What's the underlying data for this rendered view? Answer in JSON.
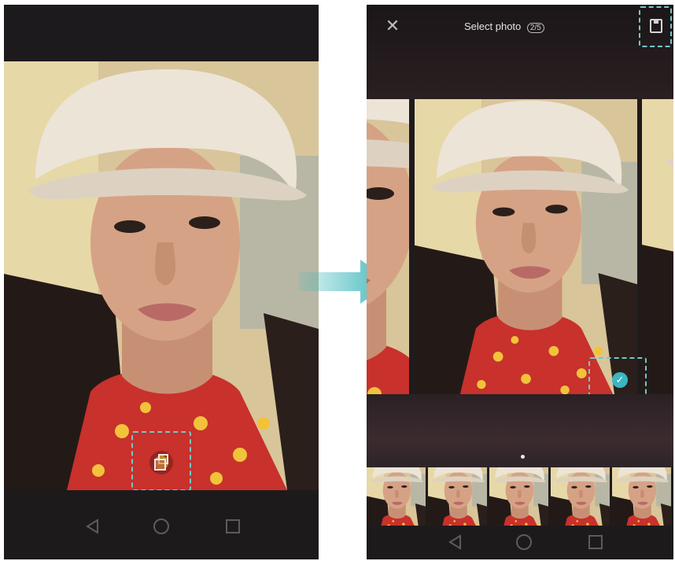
{
  "right_screen": {
    "title": "Select photo",
    "count": "2/5",
    "close_icon": "close-icon",
    "save_icon": "save-icon",
    "thumbnails": [
      "thumb-1",
      "thumb-2",
      "thumb-3",
      "thumb-4",
      "thumb-5"
    ]
  },
  "icons": {
    "back": "back-icon",
    "home": "home-icon",
    "recent": "recent-apps-icon",
    "multi_select": "multi-select-icon",
    "check": "check-icon"
  },
  "colors": {
    "highlight": "#73c7c9",
    "arrow": "#3fb8bc",
    "check": "#3bb6c2"
  }
}
